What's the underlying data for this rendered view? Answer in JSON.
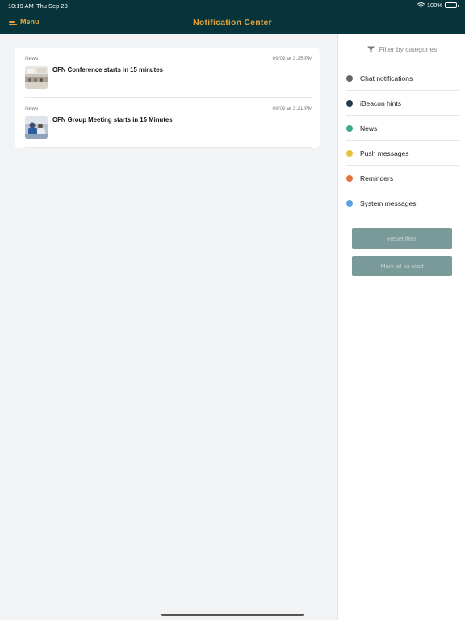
{
  "status_bar": {
    "time": "10:19 AM",
    "date": "Thu Sep 23",
    "battery": "100%"
  },
  "header": {
    "menu_label": "Menu",
    "title": "Notification Center"
  },
  "notifications": [
    {
      "category": "News",
      "timestamp": "09/02 at 3:25 PM",
      "title": "OFN Conference starts in 15 minutes"
    },
    {
      "category": "News",
      "timestamp": "09/02 at 3:21 PM",
      "title": "OFN Group Meeting starts in 15 Minutes"
    }
  ],
  "sidebar": {
    "filter_label": "Filter by categories",
    "categories": [
      {
        "label": "Chat notifications",
        "color": "#666666"
      },
      {
        "label": "iBeacon hints",
        "color": "#1f3a4d"
      },
      {
        "label": "News",
        "color": "#3aa98f"
      },
      {
        "label": "Push messages",
        "color": "#e3c23a"
      },
      {
        "label": "Reminders",
        "color": "#e0743a"
      },
      {
        "label": "System messages",
        "color": "#5aa0e0"
      }
    ],
    "reset_label": "Reset filter",
    "mark_read_label": "Mark all as read"
  },
  "colors": {
    "header_bg": "#06343a",
    "accent": "#e4a33a",
    "button_bg": "#7a9a9a"
  }
}
